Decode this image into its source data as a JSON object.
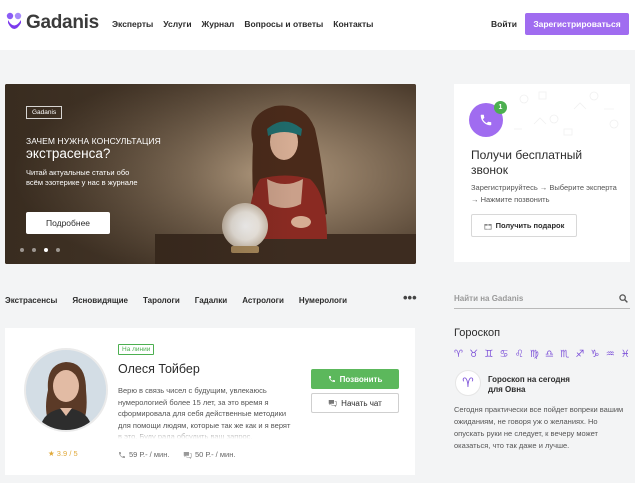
{
  "header": {
    "logo_text": "Gadanis",
    "nav": [
      "Эксперты",
      "Услуги",
      "Журнал",
      "Вопросы и ответы",
      "Контакты"
    ],
    "login": "Войти",
    "register": "Зарегистрироваться",
    "accent_color": "#a06cf0"
  },
  "banner": {
    "tag": "Gadanis",
    "kicker": "ЗАЧЕМ НУЖНА КОНСУЛЬТАЦИЯ",
    "title": "экстрасенса?",
    "description": "Читай актуальные статьи обо всём эзотерике у нас в журнале",
    "button": "Подробнее",
    "slides": 4,
    "active_slide": 3
  },
  "promo": {
    "badge": "1",
    "title": "Получи бесплатный звонок",
    "steps": "Зарегистрируйтесь → Выберите эксперта → Нажмите позвонить",
    "button": "Получить подарок",
    "icon": "phone-icon"
  },
  "categories": [
    "Экстрасенсы",
    "Ясновидящие",
    "Тарологи",
    "Гадалки",
    "Астрологи",
    "Нумерологи"
  ],
  "more_label": "•••",
  "search": {
    "placeholder": "Найти на Gadanis"
  },
  "expert": {
    "status": "На линии",
    "name": "Олеся Тойбер",
    "description": "Верю в связь чисел с будущим, увлекаюсь нумерологией более 15 лет, за это время я сформировала для себя действенные методики для помощи людям, которые так же как и я верят в это. Буду рада обсудить ваш запрос.",
    "rating": "★ 3.9 / 5",
    "rating_value": 3.9,
    "price_call": "59 Р.- / мин.",
    "price_chat": "50 Р.- / мин.",
    "call_button": "Позвонить",
    "chat_button": "Начать чат",
    "call_color": "#5cb85c"
  },
  "horoscope": {
    "title": "Гороскоп",
    "signs": [
      "♈",
      "♉",
      "♊",
      "♋",
      "♌",
      "♍",
      "♎",
      "♏",
      "♐",
      "♑",
      "♒",
      "♓"
    ],
    "head_line1": "Гороскоп на сегодня",
    "head_line2": "для Овна",
    "text": "Сегодня практически все пойдет вопреки вашим ожиданиям, не говоря уж о желаниях. Но опускать руки не следует, к вечеру может оказаться, что так даже и лучше.",
    "active_icon": "♈"
  }
}
